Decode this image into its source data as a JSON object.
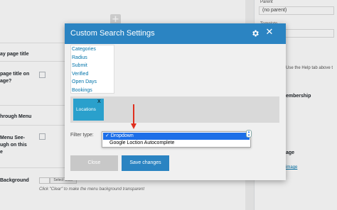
{
  "background": {
    "settings": [
      {
        "label": "ay page title"
      },
      {
        "label": "page title on\nage?"
      },
      {
        "label": "hrough Menu"
      },
      {
        "label": "Menu See-\nugh on this\ne"
      },
      {
        "label": "Background"
      }
    ],
    "select_color_label": "Select Color",
    "bg_hint": "Click \"Clear\" to make the menu background transparent"
  },
  "sidebar": {
    "parent_label": "Parent",
    "parent_value": "(no parent)",
    "template_label": "Template",
    "template_value": "late",
    "help_text": "Use the Help tab above t",
    "membership_label": "embership",
    "image_label": "age",
    "image_link": "image"
  },
  "modal": {
    "title": "Custom Search Settings",
    "fields": [
      "Categories",
      "Radius",
      "Submit",
      "Verified",
      "Open Days",
      "Bookings"
    ],
    "active_field": {
      "label": "Locations",
      "remove_label": "X"
    },
    "filter_type_label": "Filter type:",
    "filter_options": {
      "selected": "✓ Dropdown",
      "other": "Google Loction Autocomplete"
    },
    "close_label": "Close",
    "save_label": "Save changes"
  },
  "colors": {
    "header": "#2b84c2",
    "tile": "#2aa0cc",
    "highlight": "#1d6fe8",
    "arrow": "#e03020"
  }
}
